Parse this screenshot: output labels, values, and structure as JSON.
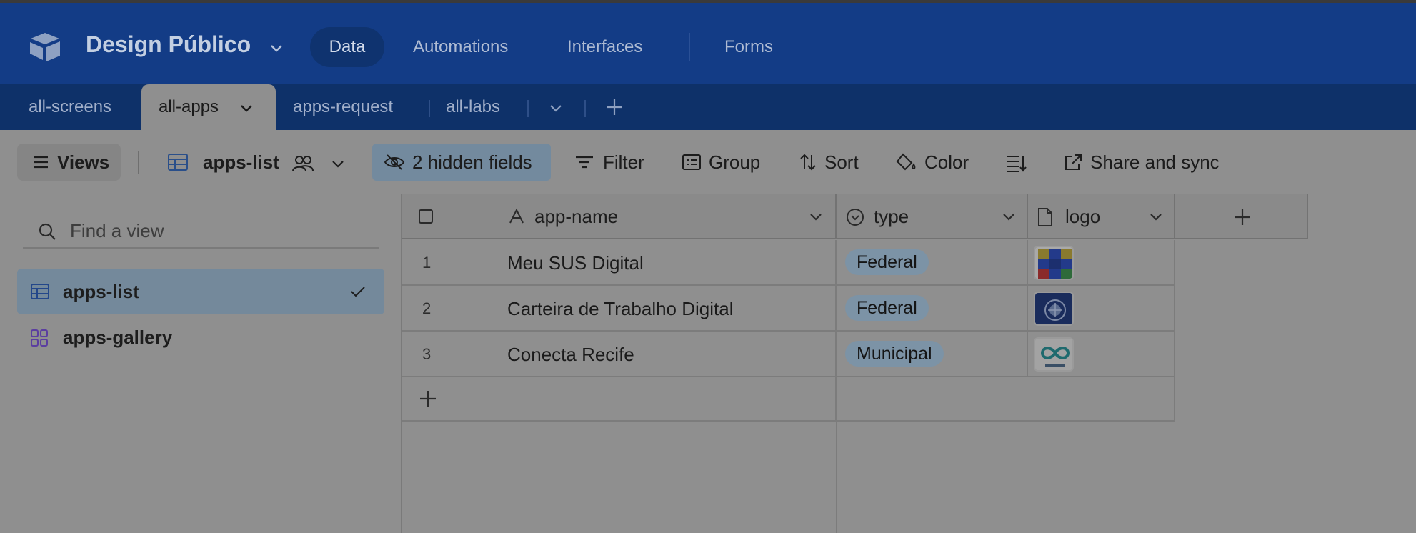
{
  "appbar": {
    "base_name": "Design Público",
    "nav": [
      "Data",
      "Automations",
      "Interfaces",
      "Forms"
    ],
    "active_nav": "Data"
  },
  "tables": {
    "tabs": [
      "all-screens",
      "all-apps",
      "apps-request",
      "all-labs"
    ],
    "active": "all-apps"
  },
  "toolbar": {
    "views_label": "Views",
    "current_view": "apps-list",
    "hidden_fields": "2 hidden fields",
    "filter": "Filter",
    "group": "Group",
    "sort": "Sort",
    "color": "Color",
    "share": "Share and sync"
  },
  "sidebar": {
    "search_placeholder": "Find a view",
    "views": [
      {
        "name": "apps-list",
        "icon": "grid-view-icon",
        "active": true
      },
      {
        "name": "apps-gallery",
        "icon": "gallery-view-icon",
        "active": false
      }
    ]
  },
  "grid": {
    "columns": [
      {
        "name": "app-name",
        "icon": "text-field-icon"
      },
      {
        "name": "type",
        "icon": "single-select-icon"
      },
      {
        "name": "logo",
        "icon": "attachment-icon"
      }
    ],
    "rows": [
      {
        "num": "1",
        "app_name": "Meu SUS Digital",
        "type": "Federal",
        "logo": "meu-sus-logo"
      },
      {
        "num": "2",
        "app_name": "Carteira de Trabalho Digital",
        "type": "Federal",
        "logo": "carteira-trabalho-logo"
      },
      {
        "num": "3",
        "app_name": "Conecta Recife",
        "type": "Municipal",
        "logo": "conecta-recife-logo"
      }
    ]
  },
  "colors": {
    "appbar": "#133c86",
    "tablebar": "#0e3169",
    "overlay_bg": "#8f8f8f",
    "pill": "#7c93a6",
    "active_view": "#74899b"
  }
}
